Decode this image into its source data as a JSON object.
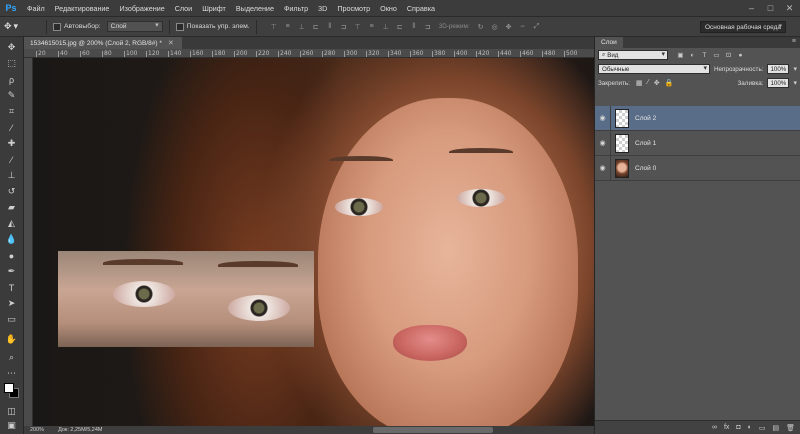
{
  "app": {
    "logo": "Ps"
  },
  "menu": [
    "Файл",
    "Редактирование",
    "Изображение",
    "Слои",
    "Шрифт",
    "Выделение",
    "Фильтр",
    "3D",
    "Просмотр",
    "Окно",
    "Справка"
  ],
  "options": {
    "autoselect_label": "Автовыбор:",
    "autoselect_value": "Слой",
    "show_transform_label": "Показать упр. элем.",
    "mode3d_label": "3D-режим:",
    "workspace": "Основная рабочая среда"
  },
  "document": {
    "tab_title": "1534615015.jpg @ 200% (Слой 2, RGB/8#) *",
    "zoom": "200%",
    "doc_size": "Док: 2,25M/5,24M"
  },
  "ruler_ticks": [
    "20",
    "40",
    "60",
    "80",
    "100",
    "120",
    "140",
    "160",
    "180",
    "200",
    "220",
    "240",
    "260",
    "280",
    "300",
    "320",
    "340",
    "360",
    "380",
    "400",
    "420",
    "440",
    "460",
    "480",
    "500"
  ],
  "layers_panel": {
    "tab": "Слои",
    "filter_type": "Вид",
    "blend_mode": "Обычные",
    "opacity_label": "Непрозрачность:",
    "opacity_value": "100%",
    "lock_label": "Закрепить:",
    "fill_label": "Заливка:",
    "fill_value": "100%",
    "layers": [
      {
        "name": "Слой 2",
        "active": true,
        "thumb": "transparent"
      },
      {
        "name": "Слой 1",
        "active": false,
        "thumb": "transparent"
      },
      {
        "name": "Слой 0",
        "active": false,
        "thumb": "photo"
      }
    ]
  },
  "colors": {
    "selected_layer": "#596d88",
    "accent": "#31a8ff"
  }
}
